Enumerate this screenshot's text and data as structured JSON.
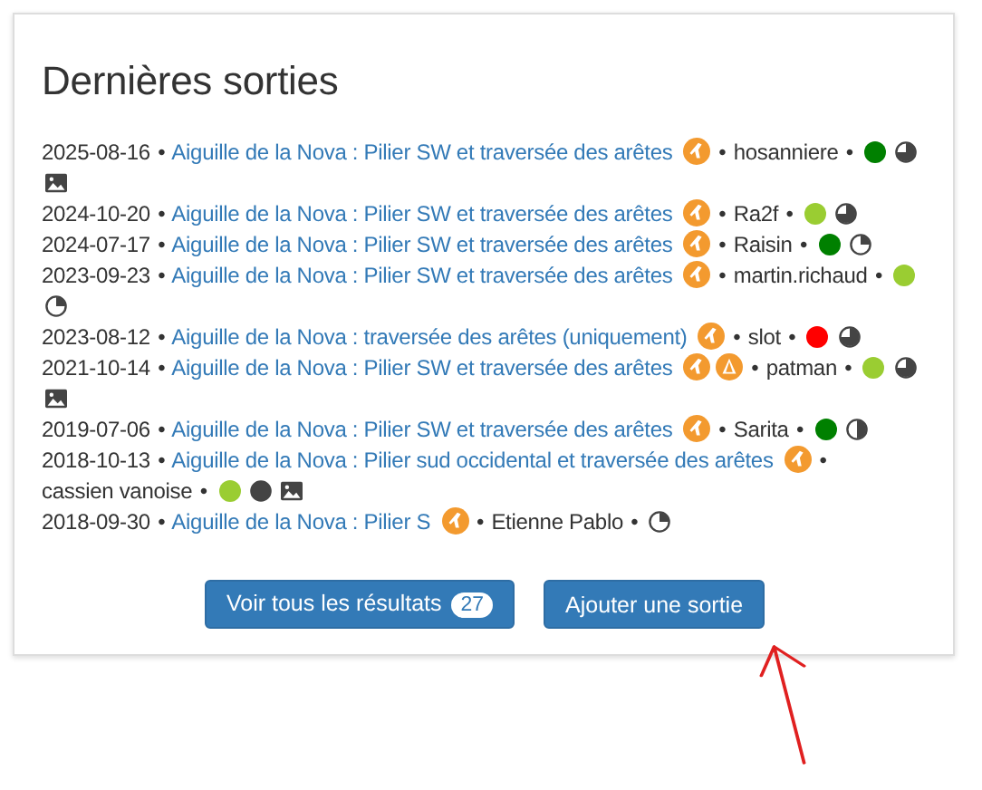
{
  "title": "Dernières sorties",
  "separator": "•",
  "outings": [
    {
      "date": "2025-08-16",
      "title": "Aiguille de la Nova : Pilier SW et traversée des arêtes",
      "activities": [
        {
          "kind": "rock_climbing"
        }
      ],
      "author": "hosanniere",
      "color": "#008000",
      "quality": {
        "kind": "three_quarters"
      },
      "has_images": true
    },
    {
      "date": "2024-10-20",
      "title": "Aiguille de la Nova : Pilier SW et traversée des arêtes",
      "activities": [
        {
          "kind": "rock_climbing"
        }
      ],
      "author": "Ra2f",
      "color": "#9acd32",
      "quality": {
        "kind": "three_quarters"
      },
      "has_images": false
    },
    {
      "date": "2024-07-17",
      "title": "Aiguille de la Nova : Pilier SW et traversée des arêtes",
      "activities": [
        {
          "kind": "rock_climbing"
        }
      ],
      "author": "Raisin",
      "color": "#008000",
      "quality": {
        "kind": "quarter"
      },
      "has_images": false
    },
    {
      "date": "2023-09-23",
      "title": "Aiguille de la Nova : Pilier SW et traversée des arêtes",
      "activities": [
        {
          "kind": "rock_climbing"
        }
      ],
      "author": "martin.richaud",
      "color": "#9acd32",
      "quality": {
        "kind": "quarter"
      },
      "has_images": false
    },
    {
      "date": "2023-08-12",
      "title": "Aiguille de la Nova : traversée des arêtes (uniquement)",
      "activities": [
        {
          "kind": "rock_climbing"
        }
      ],
      "author": "slot",
      "color": "#ff0000",
      "quality": {
        "kind": "three_quarters"
      },
      "has_images": false
    },
    {
      "date": "2021-10-14",
      "title": "Aiguille de la Nova : Pilier SW et traversée des arêtes",
      "activities": [
        {
          "kind": "rock_climbing"
        },
        {
          "kind": "mountain_climbing"
        }
      ],
      "author": "patman",
      "color": "#9acd32",
      "quality": {
        "kind": "three_quarters"
      },
      "has_images": true
    },
    {
      "date": "2019-07-06",
      "title": "Aiguille de la Nova : Pilier SW et traversée des arêtes",
      "activities": [
        {
          "kind": "rock_climbing"
        }
      ],
      "author": "Sarita",
      "color": "#008000",
      "quality": {
        "kind": "half"
      },
      "has_images": false
    },
    {
      "date": "2018-10-13",
      "title": "Aiguille de la Nova : Pilier sud occidental et traversée des arêtes",
      "activities": [
        {
          "kind": "rock_climbing"
        }
      ],
      "author": "cassien vanoise",
      "color": "#9acd32",
      "quality": {
        "kind": "full"
      },
      "has_images": true
    },
    {
      "date": "2018-09-30",
      "title": "Aiguille de la Nova : Pilier S",
      "activities": [
        {
          "kind": "rock_climbing"
        }
      ],
      "author": "Etienne Pablo",
      "quality": {
        "kind": "quarter"
      },
      "has_images": false
    }
  ],
  "buttons": [
    {
      "kind": "results",
      "label": "Voir tous les résultats",
      "count": "27"
    },
    {
      "kind": "add",
      "label": "Ajouter une sortie"
    }
  ]
}
